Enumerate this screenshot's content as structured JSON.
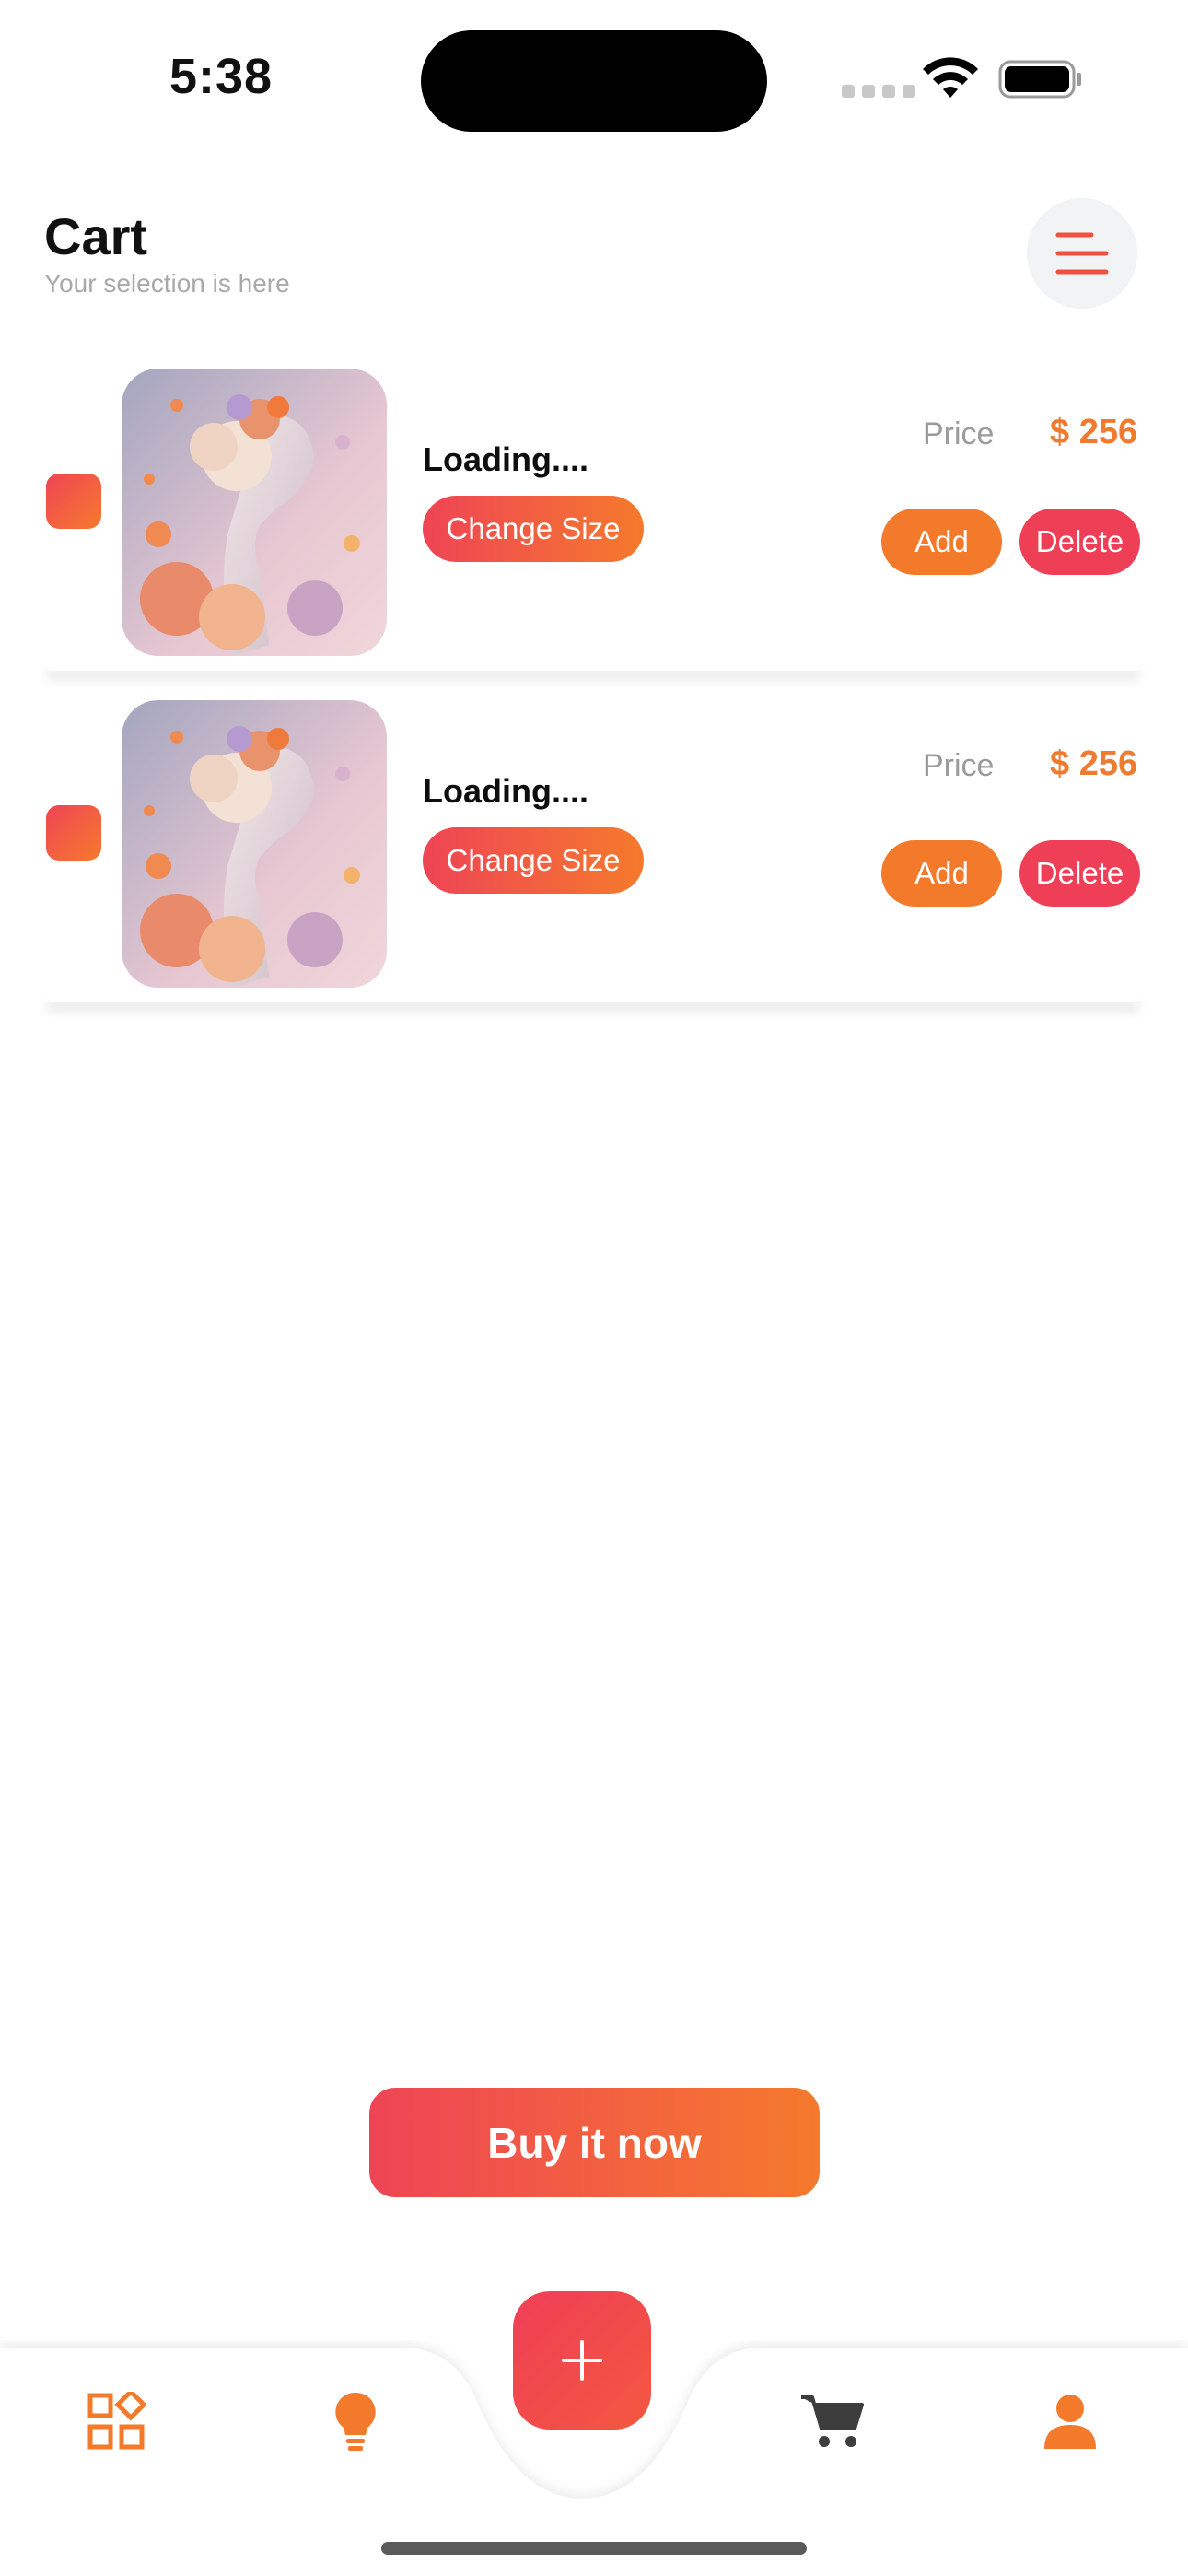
{
  "status_bar": {
    "time": "5:38"
  },
  "header": {
    "title": "Cart",
    "subtitle": "Your selection is here",
    "menu_icon": "menu-lines-icon"
  },
  "cart": {
    "items": [
      {
        "name": "Loading....",
        "change_size_label": "Change Size",
        "price_label": "Price",
        "price_value": "$ 256",
        "add_label": "Add",
        "delete_label": "Delete"
      },
      {
        "name": "Loading....",
        "change_size_label": "Change Size",
        "price_label": "Price",
        "price_value": "$ 256",
        "add_label": "Add",
        "delete_label": "Delete"
      }
    ]
  },
  "buy_button_label": "Buy it now",
  "bottom_nav": {
    "items": [
      {
        "icon": "apps-grid-icon"
      },
      {
        "icon": "lightbulb-icon"
      },
      {
        "icon": "plus-icon"
      },
      {
        "icon": "cart-icon"
      },
      {
        "icon": "user-icon"
      }
    ]
  },
  "colors": {
    "accent_orange": "#f57a2c",
    "accent_red": "#ef4456",
    "price_color": "#f07a30",
    "muted_text": "#a9a9a9"
  }
}
